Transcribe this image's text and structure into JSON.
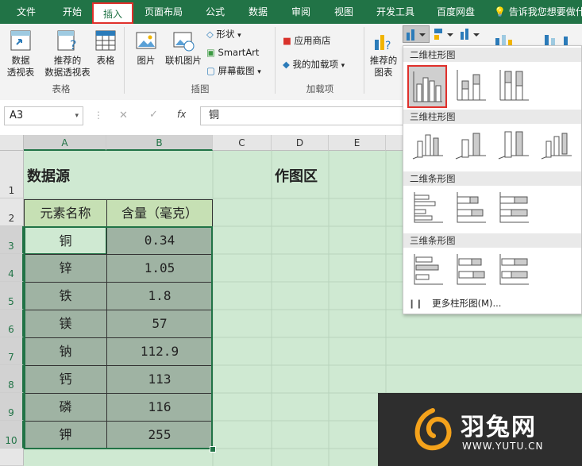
{
  "tabs": [
    "文件",
    "开始",
    "插入",
    "页面布局",
    "公式",
    "数据",
    "审阅",
    "视图",
    "开发工具",
    "百度网盘"
  ],
  "active_tab": "插入",
  "tell_me": "告诉我您想要做什么",
  "ribbon": {
    "pivot": "数据\n透视表",
    "recommended_pivot": "推荐的\n数据透视表",
    "table": "表格",
    "picture": "图片",
    "online_picture": "联机图片",
    "shapes": "形状",
    "smartart": "SmartArt",
    "screenshot": "屏幕截图",
    "store": "应用商店",
    "my_addins": "我的加载项",
    "recommended_charts": "推荐的\n图表",
    "group_tables": "表格",
    "group_illustrations": "插图",
    "group_addins": "加载项"
  },
  "formula_bar": {
    "name_box": "A3",
    "fx": "fx",
    "content": "铜"
  },
  "columns": [
    "A",
    "B",
    "C",
    "D",
    "E"
  ],
  "rows": [
    "1",
    "2",
    "3",
    "4",
    "5",
    "6",
    "7",
    "8",
    "9",
    "10"
  ],
  "sheet": {
    "title_source": "数据源",
    "title_chart_area": "作图区",
    "header_element": "元素名称",
    "header_content": "含量（毫克）",
    "data": [
      {
        "element": "铜",
        "amount": "0.34"
      },
      {
        "element": "锌",
        "amount": "1.05"
      },
      {
        "element": "铁",
        "amount": "1.8"
      },
      {
        "element": "镁",
        "amount": "57"
      },
      {
        "element": "钠",
        "amount": "112.9"
      },
      {
        "element": "钙",
        "amount": "113"
      },
      {
        "element": "磷",
        "amount": "116"
      },
      {
        "element": "钾",
        "amount": "255"
      }
    ]
  },
  "dropdown": {
    "sec_2d_column": "二维柱形图",
    "sec_3d_column": "三维柱形图",
    "sec_2d_bar": "二维条形图",
    "sec_3d_bar": "三维条形图",
    "more": "更多柱形图(M)..."
  },
  "watermark": {
    "brand": "羽兔网",
    "url": "WWW.YUTU.CN"
  },
  "colors": {
    "excel_green": "#217346",
    "highlight_red": "#e0302b",
    "header_fill": "#c6e0b4",
    "data_fill": "#9fb3a3"
  }
}
